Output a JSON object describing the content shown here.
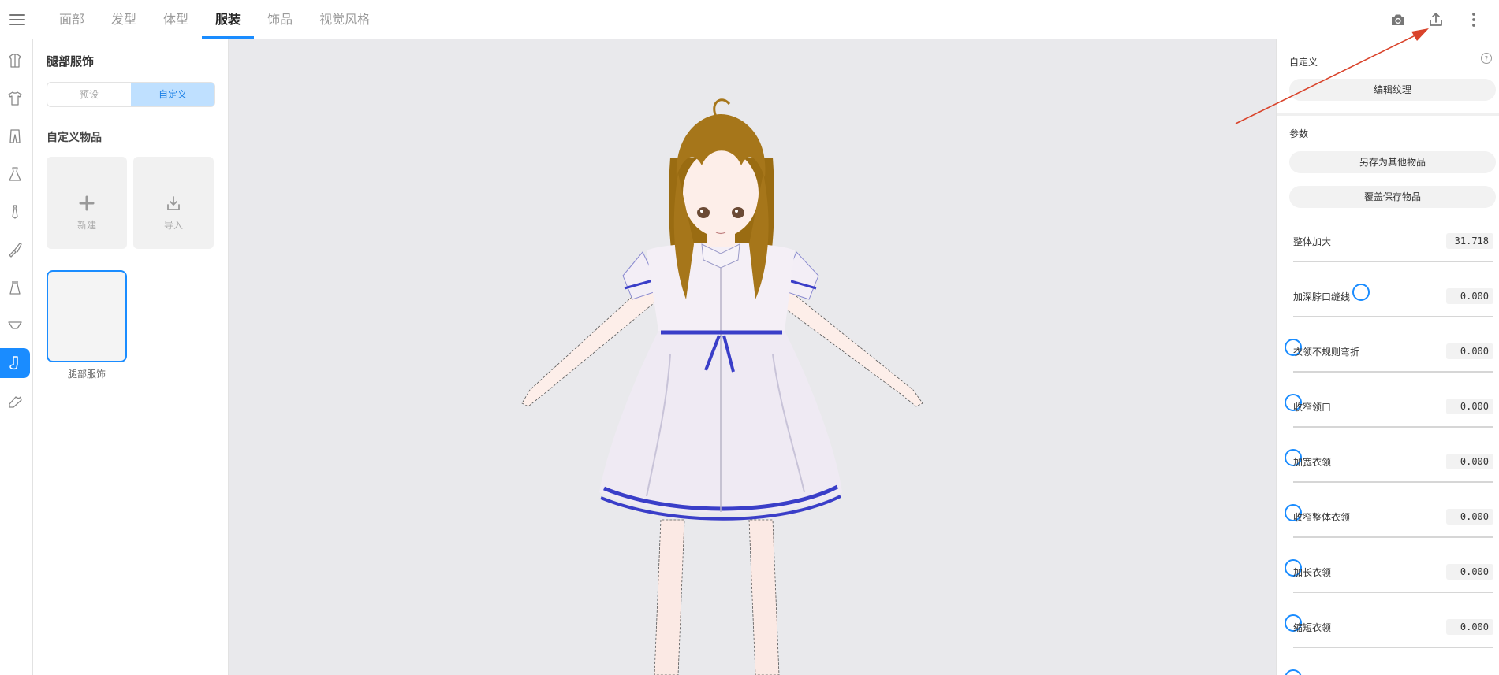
{
  "topbar": {
    "tabs": [
      {
        "label": "面部",
        "active": false
      },
      {
        "label": "发型",
        "active": false
      },
      {
        "label": "体型",
        "active": false
      },
      {
        "label": "服装",
        "active": true
      },
      {
        "label": "饰品",
        "active": false
      },
      {
        "label": "视觉风格",
        "active": false
      }
    ],
    "icons": [
      "camera-icon",
      "export-icon",
      "more-vertical-icon"
    ]
  },
  "rail": {
    "items": [
      {
        "icon": "coat-icon",
        "active": false
      },
      {
        "icon": "shirt-icon",
        "active": false
      },
      {
        "icon": "pants-icon",
        "active": false
      },
      {
        "icon": "dress-icon",
        "active": false
      },
      {
        "icon": "tie-icon",
        "active": false
      },
      {
        "icon": "glove-icon",
        "active": false
      },
      {
        "icon": "skirt-icon",
        "active": false
      },
      {
        "icon": "underwear-icon",
        "active": false
      },
      {
        "icon": "sock-icon",
        "active": true
      },
      {
        "icon": "shoe-icon",
        "active": false
      }
    ],
    "accent": "#1a8cff"
  },
  "leftpanel": {
    "title": "腿部服饰",
    "segments": {
      "preset": "预设",
      "custom": "自定义"
    },
    "section_title": "自定义物品",
    "new_label": "新建",
    "import_label": "导入",
    "item_label": "腿部服饰"
  },
  "rightpanel": {
    "custom_label": "自定义",
    "edit_texture": "编辑纹理",
    "params_label": "参数",
    "save_as_other": "另存为其他物品",
    "overwrite_save": "覆盖保存物品",
    "params": [
      {
        "name": "整体加大",
        "value": "31.718",
        "fraction": 0.338
      },
      {
        "name": "加深脖口缝线",
        "value": "0.000",
        "fraction": 0.0
      },
      {
        "name": "衣领不规则弯折",
        "value": "0.000",
        "fraction": 0.0
      },
      {
        "name": "收窄领口",
        "value": "0.000",
        "fraction": 0.0
      },
      {
        "name": "加宽衣领",
        "value": "0.000",
        "fraction": 0.0
      },
      {
        "name": "收窄整体衣领",
        "value": "0.000",
        "fraction": 0.0
      },
      {
        "name": "加长衣领",
        "value": "0.000",
        "fraction": 0.0
      },
      {
        "name": "缩短衣领",
        "value": "0.000",
        "fraction": 0.0
      }
    ]
  },
  "colors": {
    "accent": "#1a8cff",
    "segment_active_bg": "#bfe0ff",
    "annotation_arrow": "#d9432b",
    "dress_trim": "#3a3ec8"
  }
}
